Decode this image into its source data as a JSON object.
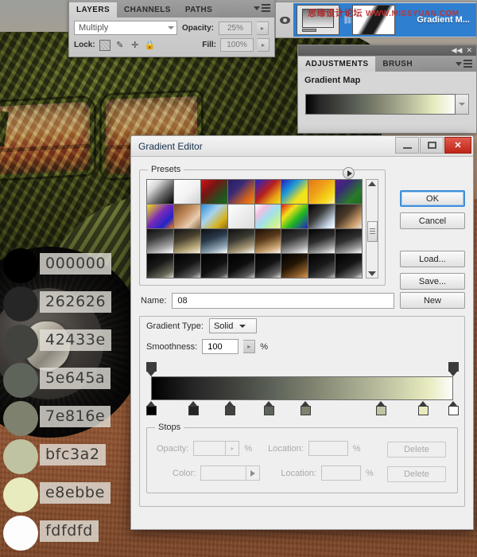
{
  "photo": {
    "description": "weathered moss-covered car in desert"
  },
  "swatches": [
    {
      "hex": "000000",
      "label": "000000"
    },
    {
      "hex": "262626",
      "label": "262626"
    },
    {
      "hex": "42433e",
      "label": "42433e"
    },
    {
      "hex": "5e645a",
      "label": "5e645a"
    },
    {
      "hex": "7e816e",
      "label": "7e816e"
    },
    {
      "hex": "bfc3a2",
      "label": "bfc3a2"
    },
    {
      "hex": "e8ebbe",
      "label": "e8ebbe"
    },
    {
      "hex": "fdfdfd",
      "label": "fdfdfd"
    }
  ],
  "layers_panel": {
    "tabs": [
      {
        "label": "LAYERS",
        "active": true
      },
      {
        "label": "CHANNELS",
        "active": false
      },
      {
        "label": "PATHS",
        "active": false
      }
    ],
    "blend_mode": "Multiply",
    "opacity_label": "Opacity:",
    "opacity_value": "25%",
    "lock_label": "Lock:",
    "fill_label": "Fill:",
    "fill_value": "100%",
    "layer": {
      "name": "Gradient M...",
      "watermark_cn": "思缘设计论坛",
      "watermark_url": "WWW.MISSYUAN.COM"
    }
  },
  "adjustments_panel": {
    "tabs": [
      {
        "label": "ADJUSTMENTS",
        "active": true
      },
      {
        "label": "BRUSH",
        "active": false
      }
    ],
    "title": "Gradient Map",
    "gradient_css": "linear-gradient(to right, #000000 0%, #262626 9%, #42433e 22%, #5e645a 35%, #7e816e 48%, #bfc3a2 72%, #e8ebbe 86%, #fdfdfd 100%)"
  },
  "dialog": {
    "title": "Gradient Editor",
    "window_buttons": {
      "minimize": "minimize-icon",
      "maximize": "maximize-icon",
      "close": "✕"
    },
    "presets": {
      "legend": "Presets",
      "swatches": [
        "linear-gradient(135deg,#ffffff 0%,#d8d8d8 28%,#6a6a6a 60%,#000000 100%)",
        "linear-gradient(135deg,#ffffff 0%,#f2f2f2 55%,#cfcfcf 100%)",
        "linear-gradient(135deg,#d11414 0%,#7a1414 35%,#2b4a1e 70%,#1c6b1c 100%)",
        "linear-gradient(135deg,#2a1a5a 0%,#3a2a78 35%,#d4641a 75%,#f08a1a 100%)",
        "linear-gradient(135deg,#2323c8 0%,#b81f1f 45%,#e8a317 75%,#f2e21a 100%)",
        "linear-gradient(135deg,#1f1fc8 0%,#1f9ad6 35%,#f2e21a 70%,#f2e21a 100%)",
        "linear-gradient(135deg,#e07a14 0%,#f0a01a 40%,#f5d91a 75%,#fff0a0 100%)",
        "linear-gradient(135deg,#5a1f8a 0%,#3a2a78 30%,#2a7a2a 70%,#1f6b1f 100%)",
        "linear-gradient(135deg,#f2e21a 0%,#7a2ab8 45%,#2323c8 75%,#f07a1a 100%)",
        "linear-gradient(135deg,#7a4a28 0%,#c08a5a 40%,#e8cdb0 70%,#8a6a4a 100%)",
        "linear-gradient(135deg,#2a8ad6 0%,#a8d4f0 40%,#d6b01a 75%,#8a6a14 100%)",
        "linear-gradient(135deg,#ffffff 0%,#ededed 50%,#dcdcdc 100%)",
        "linear-gradient(135deg,#ffffff 0%,#f0c0e0 25%,#a0e0f0 50%,#c0f0a0 75%,#f0f0a0 100%)",
        "linear-gradient(135deg,#e01414 0%,#f2e21a 30%,#1fb81f 60%,#2323c8 100%)",
        "linear-gradient(135deg,#000000 0%,#3a3a3a 40%,#c8d8e8 80%,#ffffff 100%)",
        "linear-gradient(135deg,#1a1a1a 0%,#4a3828 40%,#c89a6a 75%,#f0e0d0 100%)",
        "linear-gradient(160deg,#0d0d0d 0%,#3a3a3a 35%,#9a9a9a 70%,#ffffff 100%)",
        "linear-gradient(160deg,#141414 0%,#4a4230 40%,#b8a87a 75%,#f5f0e0 100%)",
        "linear-gradient(160deg,#0d0d12 0%,#2a3a4a 40%,#8aa0b0 75%,#ffffff 100%)",
        "linear-gradient(160deg,#101010 0%,#3a3a32 40%,#a89a78 75%,#fbfbf5 100%)",
        "linear-gradient(160deg,#1a1008 0%,#5a3a1a 40%,#c8a070 75%,#fff5e8 100%)",
        "linear-gradient(160deg,#0d0d0d 0%,#343434 40%,#a0a0a0 75%,#ffffff 100%)",
        "linear-gradient(160deg,#000000 0%,#2e2e2e 45%,#9c9c9c 78%,#ffffff 100%)",
        "linear-gradient(160deg,#080808 0%,#303030 45%,#989898 78%,#fdfdfd 100%)",
        "linear-gradient(150deg,#000000 0%,#1a1a1a 45%,#6a6a5a 80%,#d8d8c8 100%)",
        "linear-gradient(150deg,#000000 0%,#151515 50%,#5a5a5a 82%,#cfcfcf 100%)",
        "linear-gradient(150deg,#000000 0%,#101010 55%,#4a4a4a 85%,#b8b8b8 100%)",
        "linear-gradient(150deg,#000000 0%,#0d0d0d 50%,#5a5a5a 84%,#d0d0d0 100%)",
        "linear-gradient(150deg,#000000 0%,#121212 48%,#666666 82%,#dedede 100%)",
        "linear-gradient(150deg,#000000 0%,#241606 45%,#8a5a28 78%,#d89a58 100%)",
        "linear-gradient(150deg,#000000 0%,#1a1a1a 50%,#585858 84%,#cccccc 100%)",
        "linear-gradient(150deg,#000000 0%,#161616 50%,#6e6e6e 84%,#e8e8e8 100%)"
      ]
    },
    "buttons": {
      "ok": "OK",
      "cancel": "Cancel",
      "load": "Load...",
      "save": "Save...",
      "new": "New"
    },
    "name_label": "Name:",
    "name_value": "08",
    "gradient_type_label": "Gradient Type:",
    "gradient_type_value": "Solid",
    "smoothness_label": "Smoothness:",
    "smoothness_value": "100",
    "percent": "%",
    "gradient_bar": {
      "css": "linear-gradient(to right, #000000 0%, #262626 14%, #42433e 28%, #5e645a 41%, #7e816e 53%, #bfc3a2 78%, #e8ebbe 92%, #fdfdfd 100%)",
      "opacity_stops": [
        {
          "location": 0,
          "opacity": 100
        },
        {
          "location": 100,
          "opacity": 100
        }
      ],
      "color_stops": [
        {
          "location": 0,
          "color": "#000000"
        },
        {
          "location": 14,
          "color": "#262626"
        },
        {
          "location": 26,
          "color": "#42433e"
        },
        {
          "location": 39,
          "color": "#5e645a"
        },
        {
          "location": 51,
          "color": "#7e816e"
        },
        {
          "location": 76,
          "color": "#bfc3a2"
        },
        {
          "location": 90,
          "color": "#e8ebbe"
        },
        {
          "location": 100,
          "color": "#fdfdfd"
        }
      ]
    },
    "stops": {
      "legend": "Stops",
      "opacity_label": "Opacity:",
      "opacity_value": "",
      "opacity_location_label": "Location:",
      "opacity_location_value": "",
      "color_label": "Color:",
      "color_location_label": "Location:",
      "color_location_value": "",
      "delete_label": "Delete",
      "percent": "%"
    }
  }
}
